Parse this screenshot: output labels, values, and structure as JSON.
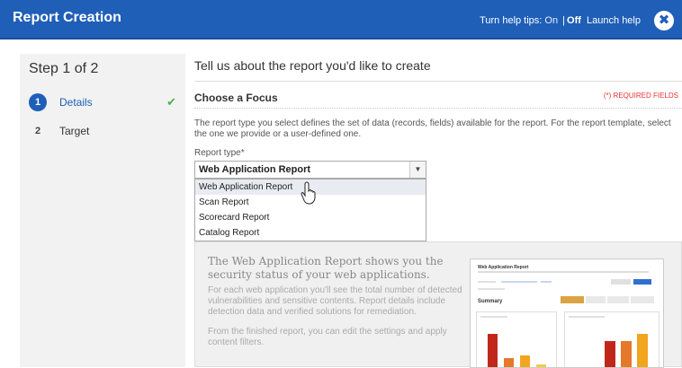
{
  "header": {
    "title": "Report Creation",
    "help_tips_label": "Turn help tips:",
    "help_on": "On",
    "help_off": "Off",
    "help_sep": "|",
    "launch_help": "Launch help",
    "close_icon": "close-icon",
    "close_glyph": "✖"
  },
  "sidebar": {
    "step_title": "Step 1 of 2",
    "steps": [
      {
        "number": "1",
        "label": "Details",
        "state": "active",
        "completed": true
      },
      {
        "number": "2",
        "label": "Target",
        "state": "inactive",
        "completed": false
      }
    ],
    "check_glyph": "✔"
  },
  "main": {
    "intro": "Tell us about the report you'd like to create",
    "section_title": "Choose a Focus",
    "required_note": "(*) REQUIRED FIELDS",
    "description": "The report type you select defines the set of data (records, fields) available for the report. For the report template, select the one we provide or a user-defined one.",
    "report_type_label": "Report type*",
    "report_type_value": "Web Application Report",
    "dropdown_arrow": "▼",
    "options": [
      "Web Application Report",
      "Scan Report",
      "Scorecard Report",
      "Catalog Report"
    ],
    "highlighted_option_index": 0,
    "info": {
      "heading": "The Web Application Report shows you the security status of your web applications.",
      "para1": "For each web application you'll see the total number of detected vulnerabilities and sensitive contents. Report details include detection data and verified solutions for remediation.",
      "para2": "From the finished report, you can edit the settings and apply content filters."
    },
    "preview": {
      "title": "Web Application Report",
      "summary": "Summary"
    }
  },
  "colors": {
    "header_bg": "#1f5fb8",
    "sidebar_bg": "#f2f2f2",
    "check": "#4caf50",
    "required": "#ee3333",
    "bar_red": "#c0271a",
    "bar_orange": "#e5782a",
    "bar_yellow": "#f2a51f"
  }
}
